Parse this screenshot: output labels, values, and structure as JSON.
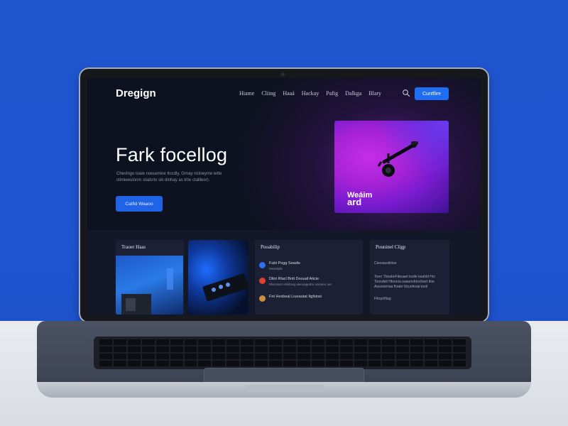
{
  "site": {
    "logo": "Dregign",
    "nav": [
      "Hiame",
      "Cliing",
      "Haaá",
      "Hackay",
      "Pafig",
      "Dalkga",
      "Blary"
    ],
    "cta_top": "Cuntfiire"
  },
  "hero": {
    "title": "Fark focellog",
    "subtitle": "Cheshigo toale rxeoamioe tlocdly, Grnay rictoeyme lette ctimieeuinnm stialcrio sik dinhay as trite ctallleor).",
    "cta": "Catfid Waaoo",
    "image_caption_line1": "Weáim",
    "image_caption_line2": "ard"
  },
  "cards": {
    "left_title": "Traoer Haas",
    "middle_title": "Pooabilip",
    "right_title": "Pouninel Cligp",
    "middle_items": [
      {
        "title": "Fubt Pogg Seadis",
        "sub": "Petretidle",
        "color": "#2f6ff0"
      },
      {
        "title": "Dilot Rlacl Bntt Doouaf Aticie",
        "sub": "Rlacolent vsbibreg aieooagedre ooicaeo oet",
        "color": "#e0402c"
      },
      {
        "title": "Fnt Hexbeal Liuoautat Itgfsiosi",
        "sub": "",
        "color": "#c98f3a"
      }
    ],
    "right_lines": [
      "Cteosiaotiitioe",
      "Toerr TbeabeFiteuaet lostle kaahbl Hcr",
      "Tooodeti Htorsoa oaaunolrtocheet Itoe",
      "Aosooieriaa ftoabr Iilcuofeoai tooil",
      "Fibqorlftag"
    ]
  },
  "colors": {
    "background": "#1f56cf",
    "accent": "#1e6df2",
    "screen": "#0e1220"
  }
}
